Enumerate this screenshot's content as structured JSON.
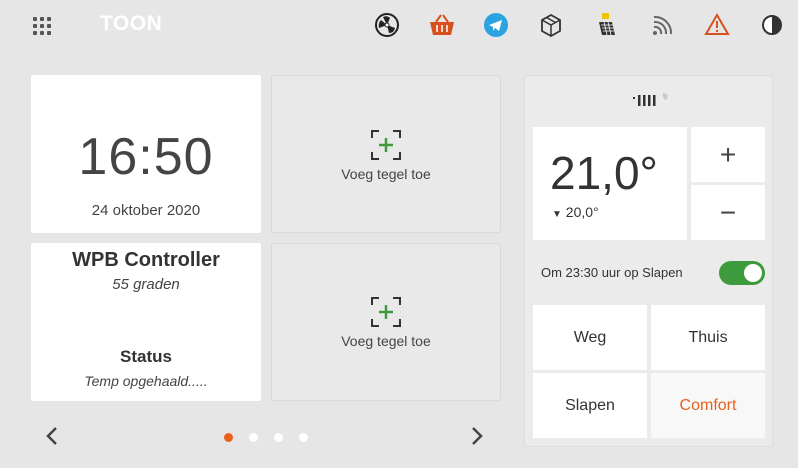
{
  "app": {
    "logo": "TOON"
  },
  "status_icons": [
    "fan-icon",
    "basket-icon",
    "telegram-icon",
    "box-icon",
    "solar-panel-icon",
    "wifi-icon",
    "warning-icon",
    "contrast-icon"
  ],
  "colors": {
    "accent": "#e8601c",
    "toggle_on": "#3d9a3d",
    "telegram": "#2ba3e0",
    "basket": "#d9501f",
    "warning": "#d9501f",
    "add_plus": "#3d9a3d"
  },
  "clock": {
    "time": "16:50",
    "date": "24 oktober 2020"
  },
  "add_tile": {
    "label": "Voeg tegel toe"
  },
  "wpb": {
    "title": "WPB Controller",
    "subtitle": "55 graden",
    "status_title": "Status",
    "status_value": "Temp opgehaald....."
  },
  "pager": {
    "pages": 4,
    "active_page": 1
  },
  "thermostat": {
    "current_temp": "21,0°",
    "setpoint": "20,0°",
    "plus_label": "+",
    "minus_label": "−",
    "program_text": "Om 23:30 uur op Slapen",
    "program_enabled": true,
    "presets": [
      "Weg",
      "Thuis",
      "Slapen",
      "Comfort"
    ],
    "selected_preset": "Comfort"
  }
}
